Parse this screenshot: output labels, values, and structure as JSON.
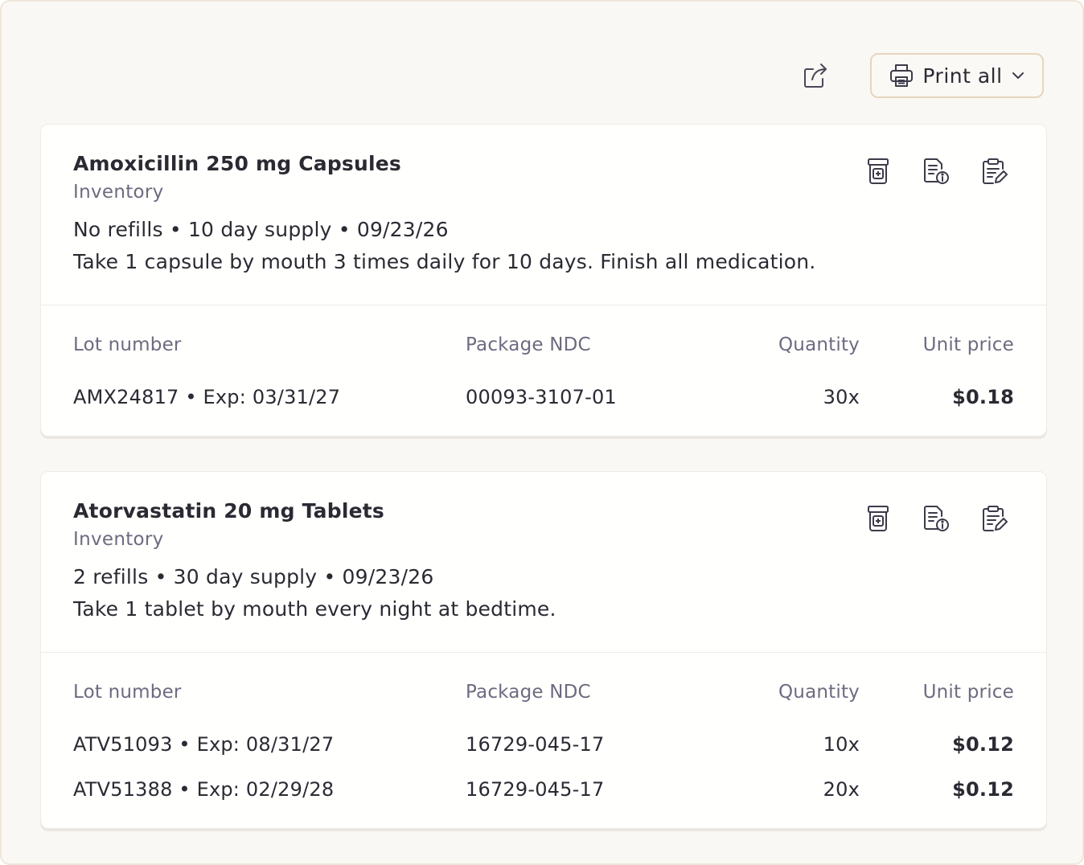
{
  "toolbar": {
    "share_icon": "share-icon",
    "print_icon": "printer-icon",
    "print_label": "Print all",
    "print_chevron": "chevron-down-icon"
  },
  "columns": {
    "lot": "Lot number",
    "ndc": "Package NDC",
    "qty": "Quantity",
    "price": "Unit price"
  },
  "prescriptions": [
    {
      "name": "Amoxicillin 250 mg Capsules",
      "source": "Inventory",
      "summary": "No refills • 10 day supply • 09/23/26",
      "sig": "Take 1 capsule by mouth 3 times daily for 10 days. Finish all medication.",
      "actions": [
        "pill-bottle-icon",
        "document-info-icon",
        "clipboard-edit-icon"
      ],
      "lots": [
        {
          "lot": "AMX24817 • Exp: 03/31/27",
          "ndc": "00093-3107-01",
          "qty": "30x",
          "price": "$0.18"
        }
      ]
    },
    {
      "name": "Atorvastatin 20 mg Tablets",
      "source": "Inventory",
      "summary": "2 refills • 30 day supply • 09/23/26",
      "sig": "Take 1 tablet by mouth every night at bedtime.",
      "actions": [
        "pill-bottle-icon",
        "document-info-icon",
        "clipboard-edit-icon"
      ],
      "lots": [
        {
          "lot": "ATV51093 • Exp: 08/31/27",
          "ndc": "16729-045-17",
          "qty": "10x",
          "price": "$0.12"
        },
        {
          "lot": "ATV51388 • Exp: 02/29/28",
          "ndc": "16729-045-17",
          "qty": "20x",
          "price": "$0.12"
        }
      ]
    }
  ]
}
